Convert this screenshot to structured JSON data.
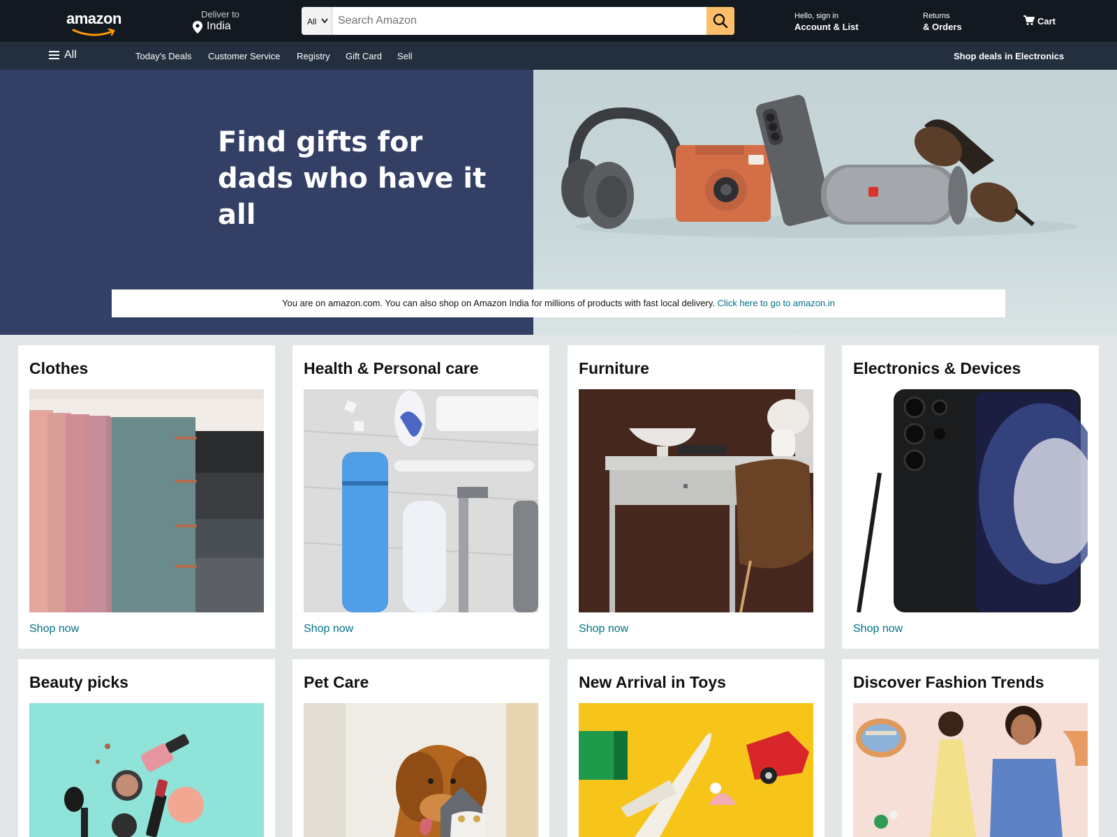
{
  "header": {
    "logo_text": "amazon",
    "deliver_line1": "Deliver to",
    "deliver_line2": "India",
    "search_category": "All",
    "search_placeholder": "Search Amazon",
    "account_line1": "Hello, sign in",
    "account_line2": "Account & List",
    "returns_line1": "Returns",
    "returns_line2": "& Orders",
    "cart_label": "Cart"
  },
  "subnav": {
    "all_label": "All",
    "links": [
      "Today's Deals",
      "Customer Service",
      "Registry",
      "Gift Card",
      "Sell"
    ],
    "promo": "Shop deals in Electronics"
  },
  "hero": {
    "title_line1": "Find gifts for",
    "title_line2": "dads who have it all",
    "notice_text": "You are on amazon.com. You can also shop on Amazon India for millions of products with fast local delivery. ",
    "notice_link": "Click here to go to amazon.in"
  },
  "cards": [
    {
      "title": "Clothes",
      "link": "Shop now"
    },
    {
      "title": "Health & Personal care",
      "link": "Shop now"
    },
    {
      "title": "Furniture",
      "link": "Shop now"
    },
    {
      "title": "Electronics & Devices",
      "link": "Shop now"
    },
    {
      "title": "Beauty picks"
    },
    {
      "title": "Pet Care"
    },
    {
      "title": "New Arrival in Toys"
    },
    {
      "title": "Discover Fashion Trends"
    }
  ],
  "colors": {
    "nav_bg": "#131921",
    "subnav_bg": "#232f3e",
    "search_button": "#febd69",
    "link": "#007185",
    "hero_left": "#333f65"
  }
}
